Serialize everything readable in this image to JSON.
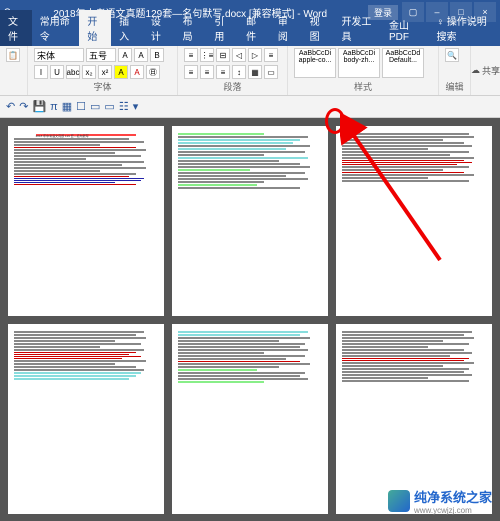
{
  "titlebar": {
    "doc_title": "2018年中考语文真题129套—名句默写.docx [兼容模式] - Word",
    "login": "登录",
    "min": "–",
    "max": "□",
    "close": "×",
    "display_opts": "▢"
  },
  "menu": {
    "file": "文件",
    "tabs": [
      "常用命令",
      "开始",
      "插入",
      "设计",
      "布局",
      "引用",
      "邮件",
      "审阅",
      "视图",
      "开发工具",
      "金山PDF"
    ],
    "tell_me": "操作说明搜索",
    "active_index": 1,
    "share": "共享"
  },
  "ribbon": {
    "font": {
      "family": "宋体",
      "size": "五号",
      "label": "字体"
    },
    "paragraph": {
      "label": "段落"
    },
    "styles": {
      "label": "样式",
      "items": [
        {
          "name": "AaBbCcDi",
          "sub": "apple-co..."
        },
        {
          "name": "AaBbCcDi",
          "sub": "body-zh..."
        },
        {
          "name": "AaBbCcDd",
          "sub": "Default..."
        }
      ]
    },
    "editing": {
      "label": "编辑"
    }
  },
  "qat": {
    "icons": [
      "undo",
      "redo",
      "save",
      "pi",
      "doc",
      "table",
      "chart",
      "img",
      "shape",
      "more"
    ]
  },
  "chart_data": null,
  "document": {
    "page1_title": "2018 年中考语文真题 129 套—名句默写"
  },
  "watermark": {
    "brand": "纯净系统之家",
    "url": "www.ycwjzj.com"
  }
}
